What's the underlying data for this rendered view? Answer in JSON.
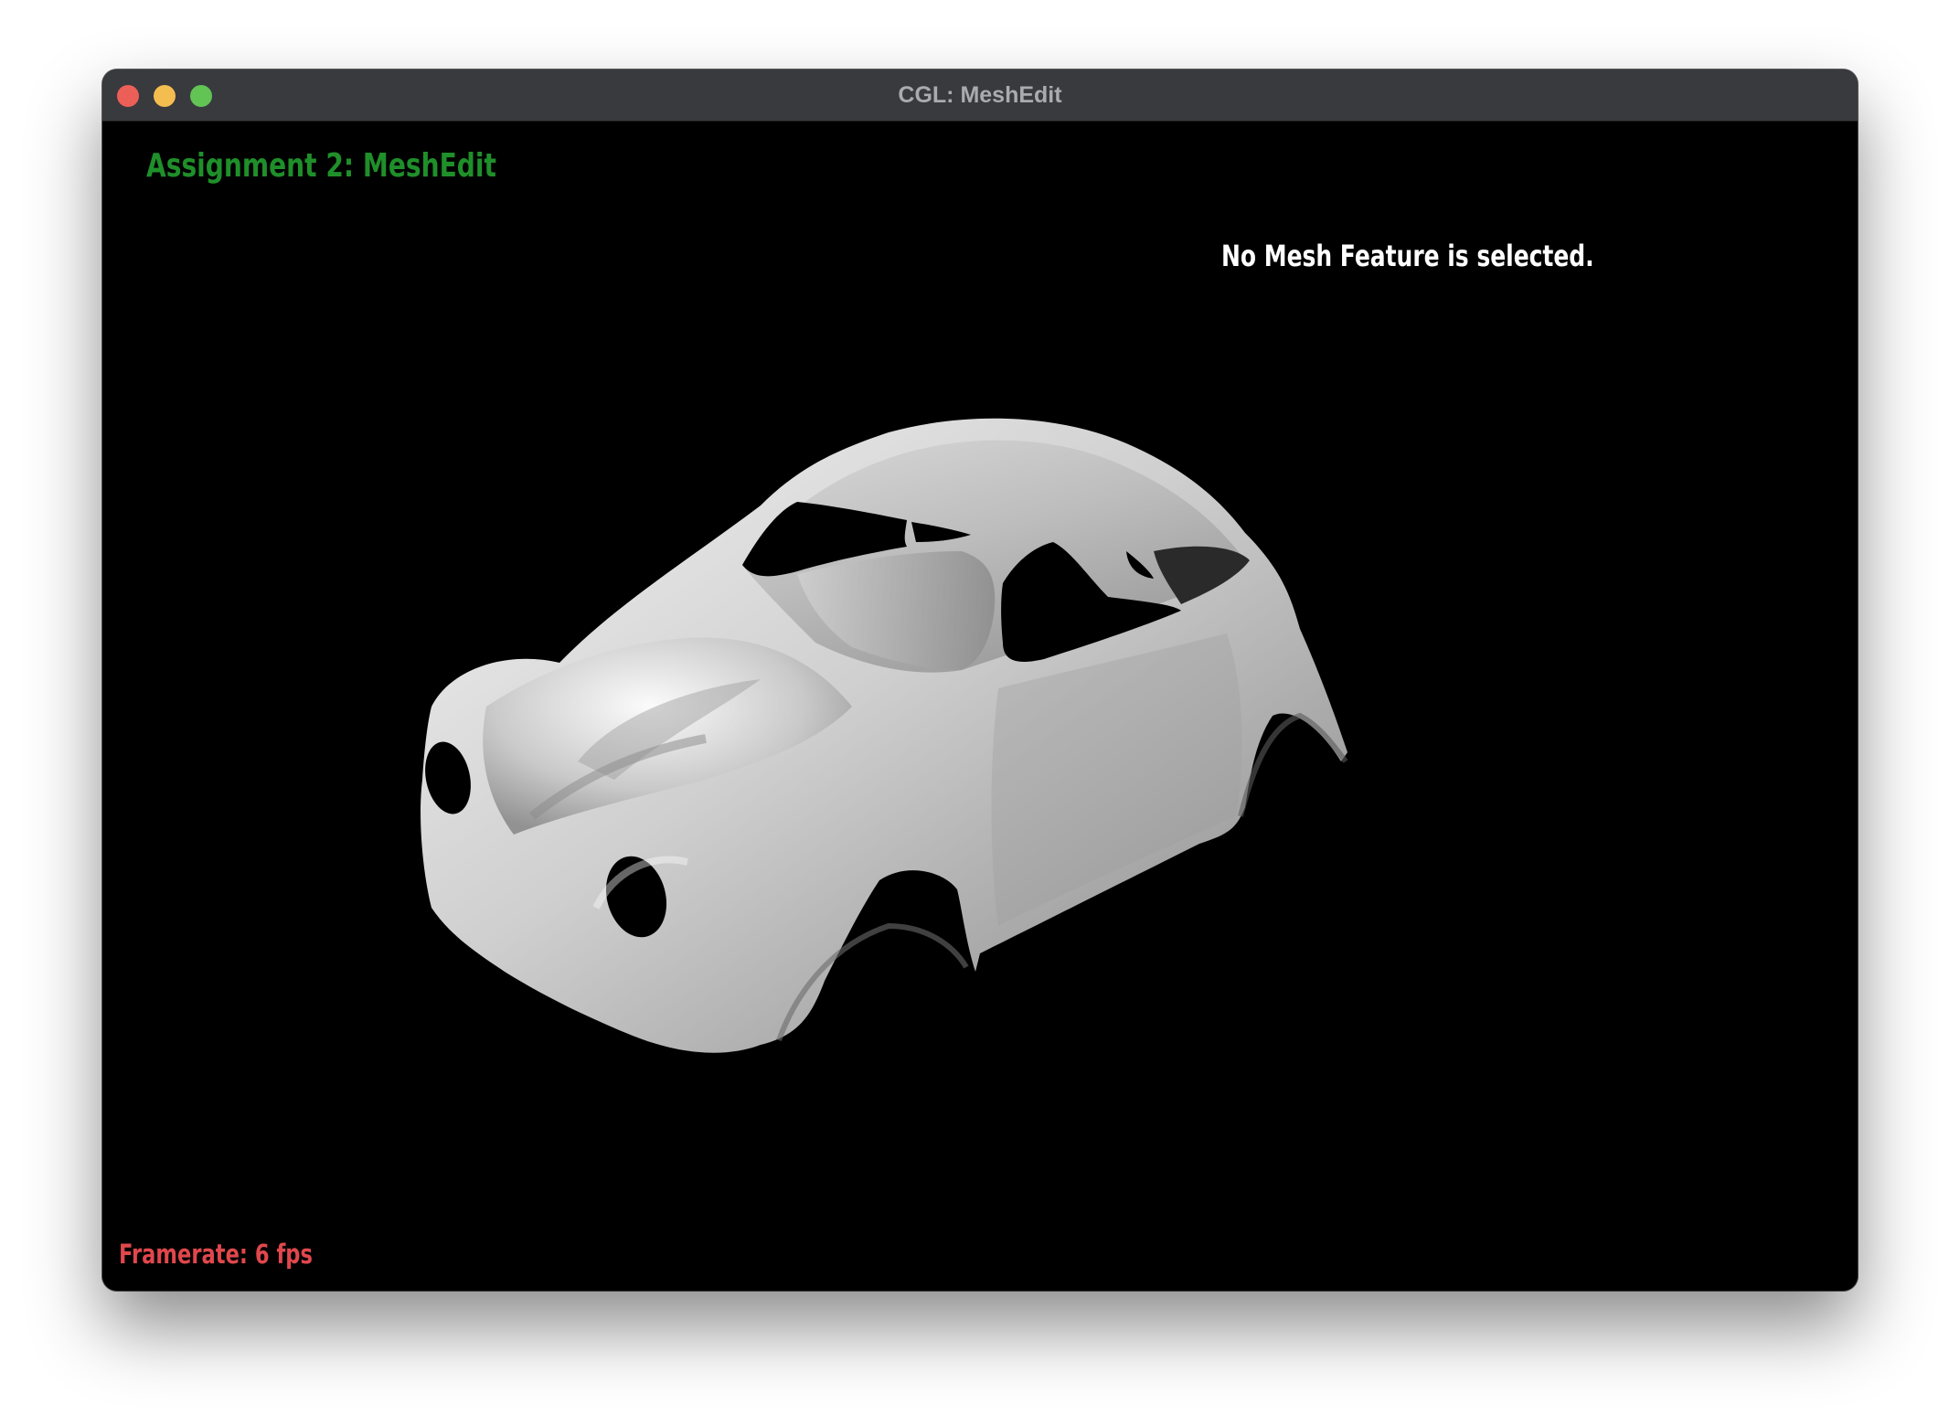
{
  "window": {
    "title": "CGL: MeshEdit"
  },
  "viewport": {
    "app_title": "Assignment 2: MeshEdit",
    "selection_status": "No Mesh Feature is selected.",
    "framerate": "Framerate: 6 fps",
    "model_subject": "car-body-mesh"
  },
  "colors": {
    "titlebar": "#383a3e",
    "app_title": "#1f8f2a",
    "status_text": "#ffffff",
    "framerate": "#e0474c",
    "traffic_close": "#ec5f57",
    "traffic_min": "#f4bd4f",
    "traffic_max": "#61c454"
  }
}
